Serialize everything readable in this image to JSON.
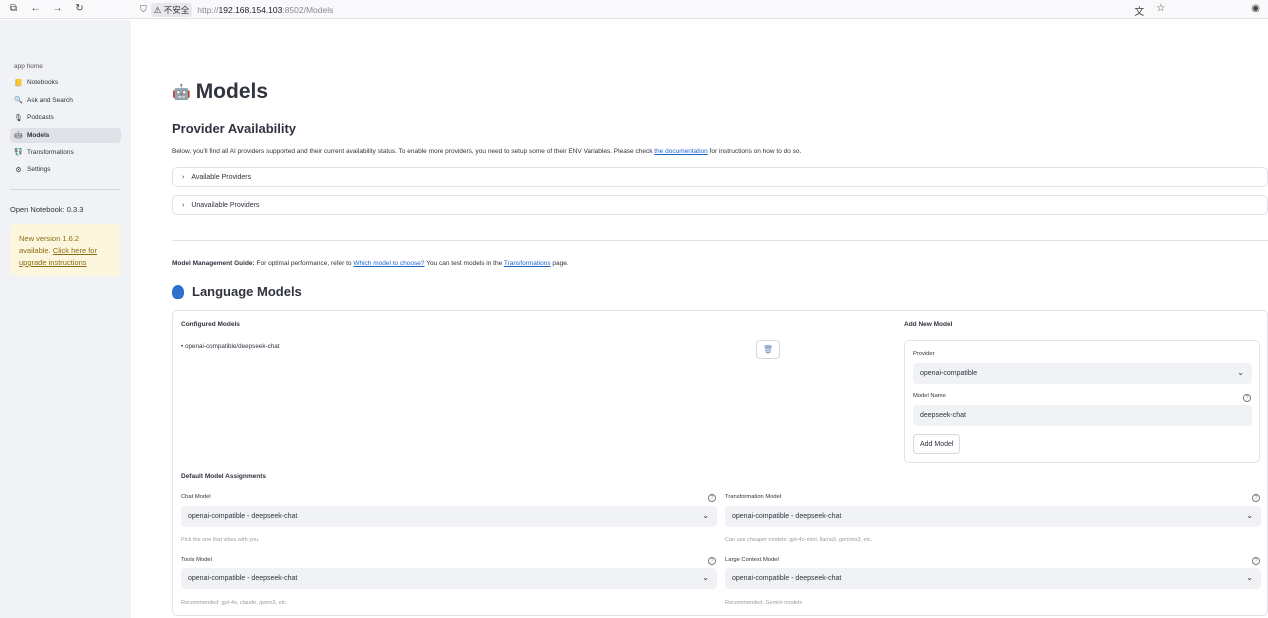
{
  "browser": {
    "insecure_label": "不安全",
    "url_prefix": "http://",
    "url_host": "192.168.154.103",
    "url_rest": ":8502/Models"
  },
  "sidebar": {
    "app_home": "app home",
    "items": [
      {
        "label": "Notebooks",
        "icon": "📒"
      },
      {
        "label": "Ask and Search",
        "icon": "🔍"
      },
      {
        "label": "Podcasts",
        "icon": "🎙"
      },
      {
        "label": "Models",
        "icon": "🤖"
      },
      {
        "label": "Transformations",
        "icon": "💱"
      },
      {
        "label": "Settings",
        "icon": "⚙"
      }
    ],
    "version": "Open Notebook: 0.3.3",
    "update_text": "New version 1.6.2 available.",
    "update_link": "Click here for upgrade instructions"
  },
  "main": {
    "title": "Models",
    "provider_heading": "Provider Availability",
    "provider_desc_before": "Below, you'll find all AI providers supported and their current availability status. To enable more providers, you need to setup some of their ENV Variables. Please check ",
    "provider_desc_link": "the documentation",
    "provider_desc_after": " for instructions on how to do so.",
    "available_label": "Available Providers",
    "unavailable_label": "Unavailable Providers",
    "guide_bold": "Model Management Guide:",
    "guide_before": " For optimal performance, refer to ",
    "guide_link1": "Which model to choose?",
    "guide_mid": " You can test models in the ",
    "guide_link2": "Transformations",
    "guide_after": " page.",
    "lm_heading": "Language Models",
    "configured_heading": "Configured Models",
    "configured_models": [
      "• openai-compatible/deepseek-chat"
    ],
    "add_heading": "Add New Model",
    "provider_label": "Provider",
    "provider_value": "openai-compatible",
    "model_name_label": "Model Name",
    "model_name_value": "deepseek-chat",
    "add_button": "Add Model",
    "defaults_heading": "Default Model Assignments",
    "chat_label": "Chat Model",
    "chat_value": "openai-compatible - deepseek-chat",
    "chat_hint": "Pick the one that vibes with you.",
    "transform_label": "Transformation Model",
    "transform_value": "openai-compatible - deepseek-chat",
    "transform_hint": "Can use cheaper models: gpt-4o-mini, llama3, gemma3, etc.",
    "tools_label": "Tools Model",
    "tools_value": "openai-compatible - deepseek-chat",
    "tools_hint": "Recommended: gpt-4o, claude, qwen3, etc.",
    "large_label": "Large Context Model",
    "large_value": "openai-compatible - deepseek-chat",
    "large_hint": "Recommended: Gemini models"
  }
}
